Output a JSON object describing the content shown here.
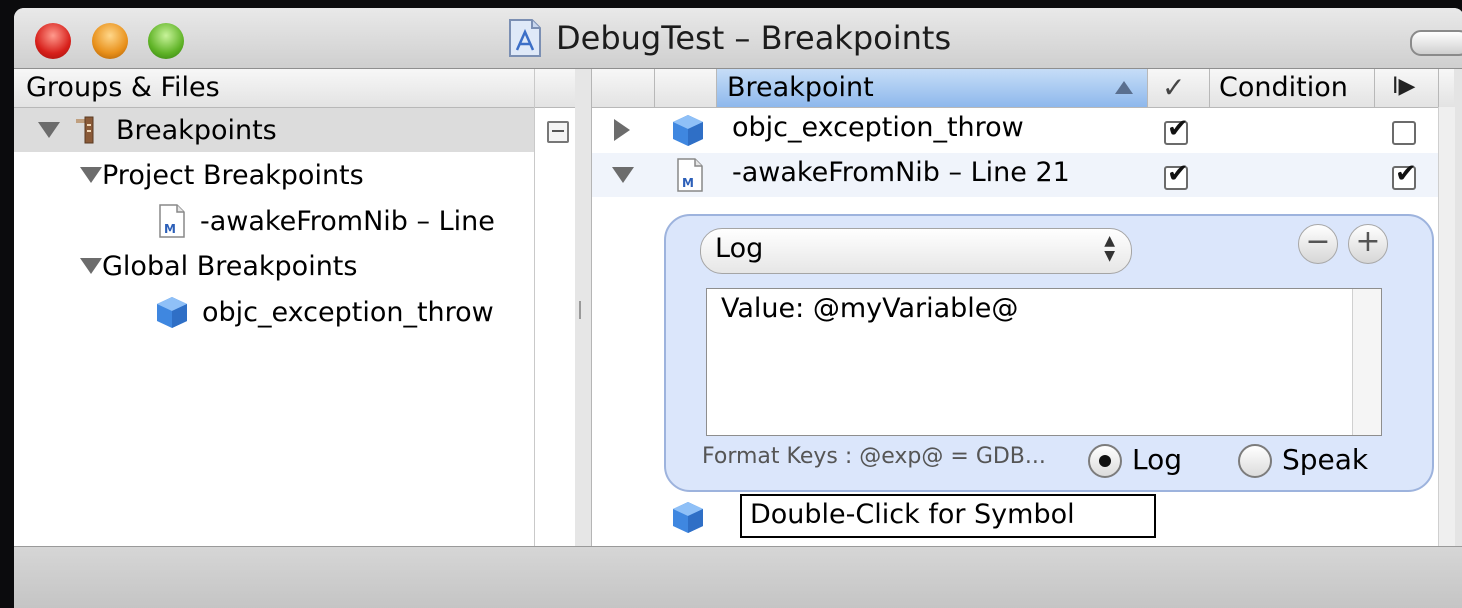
{
  "window": {
    "title": "DebugTest – Breakpoints"
  },
  "left_pane": {
    "header": "Groups & Files",
    "tree": {
      "root": "Breakpoints",
      "project_group": "Project Breakpoints",
      "project_item": "-awakeFromNib – Line",
      "global_group": "Global Breakpoints",
      "global_item": "objc_exception_throw"
    }
  },
  "table": {
    "columns": {
      "breakpoint": "Breakpoint",
      "enabled": "✓",
      "condition": "Condition",
      "continue": "I▶"
    },
    "rows": [
      {
        "name": "objc_exception_throw",
        "enabled": true,
        "continue": false
      },
      {
        "name": "-awakeFromNib – Line 21",
        "enabled": true,
        "continue": true
      }
    ],
    "new_row_placeholder": "Double-Click for Symbol"
  },
  "action_panel": {
    "action_type": "Log",
    "remove_label": "−",
    "add_label": "+",
    "message": "Value: @myVariable@",
    "format_keys": "Format Keys : @exp@ = GDB...",
    "radio_log": "Log",
    "radio_speak": "Speak",
    "selected_output": "Log"
  }
}
